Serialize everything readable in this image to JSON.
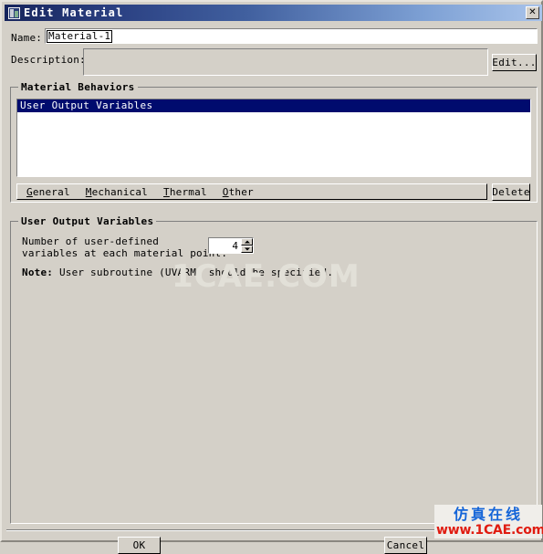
{
  "window": {
    "title": "Edit Material",
    "icon": "material-icon",
    "close_label": "✕",
    "bg_color": "#d4d0c8",
    "titlebar_start_color": "#16245c",
    "titlebar_end_color": "#a8c3ea"
  },
  "name_field": {
    "label": "Name:",
    "value": "Material-1"
  },
  "description_field": {
    "label": "Description:",
    "value": "",
    "edit_button": "Edit..."
  },
  "material_behaviors": {
    "group_title": "Material Behaviors",
    "list_items": [
      {
        "label": "User Output Variables",
        "selected": true
      }
    ],
    "selection_color": "#000b6e",
    "menu": [
      {
        "mnemonic": "G",
        "rest": "eneral"
      },
      {
        "mnemonic": "M",
        "rest": "echanical"
      },
      {
        "mnemonic": "T",
        "rest": "hermal"
      },
      {
        "mnemonic": "O",
        "rest": "ther"
      }
    ],
    "delete_button": "Delete"
  },
  "user_output_variables": {
    "group_title": "User Output Variables",
    "prompt_line1": "Number of user-defined",
    "prompt_line2": "variables at each material point:",
    "count_value": "4",
    "note_bold": "Note:",
    "note_rest": " User subroutine (UVARM) should be specified."
  },
  "footer": {
    "ok_label": "OK",
    "cancel_label": "Cancel"
  },
  "watermark": {
    "center_text": "1CAE.COM",
    "logo_cn": "仿真在线",
    "logo_url": "www.1CAE.com",
    "logo_cn_color": "#1565d8",
    "logo_url_color": "#e01b10"
  }
}
